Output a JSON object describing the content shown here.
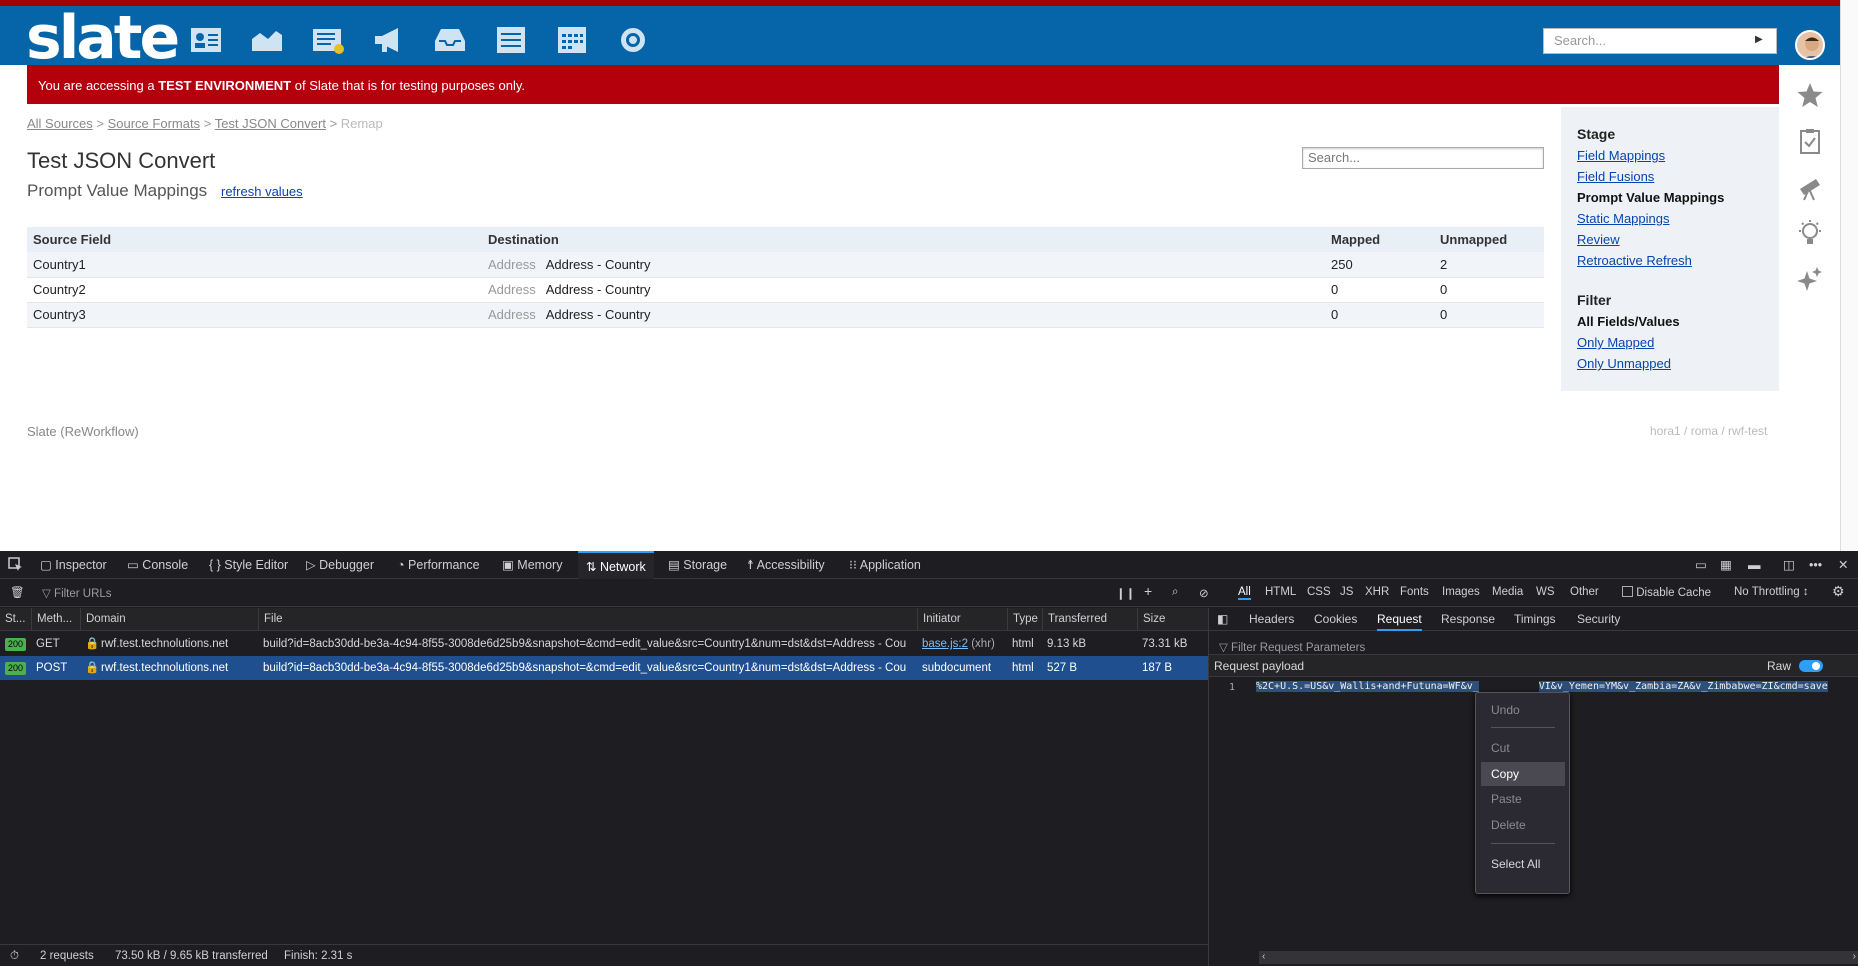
{
  "header": {
    "logo": "slate",
    "search_placeholder": "Search...",
    "nav_icons": [
      "contacts-icon",
      "chart-icon",
      "news-icon",
      "megaphone-icon",
      "inbox-icon",
      "list-icon",
      "calendar-icon",
      "settings-icon"
    ]
  },
  "banner": {
    "prefix": "You are accessing a ",
    "strong": "TEST ENVIRONMENT",
    "suffix": " of Slate that is for testing purposes only."
  },
  "breadcrumb": {
    "items": [
      "All Sources",
      "Source Formats",
      "Test JSON Convert"
    ],
    "current": "Remap",
    "sep": ">"
  },
  "page": {
    "title": "Test JSON Convert",
    "subtitle": "Prompt Value Mappings",
    "refresh": "refresh values",
    "search_placeholder": "Search..."
  },
  "table": {
    "headers": [
      "Source Field",
      "Destination",
      "Mapped",
      "Unmapped"
    ],
    "rows": [
      {
        "source": "Country1",
        "dest_prefix": "Address",
        "dest": "Address - Country",
        "mapped": "250",
        "unmapped": "2"
      },
      {
        "source": "Country2",
        "dest_prefix": "Address",
        "dest": "Address - Country",
        "mapped": "0",
        "unmapped": "0"
      },
      {
        "source": "Country3",
        "dest_prefix": "Address",
        "dest": "Address - Country",
        "mapped": "0",
        "unmapped": "0"
      }
    ]
  },
  "sidebar": {
    "stage_title": "Stage",
    "stage": [
      "Field Mappings",
      "Field Fusions",
      "Prompt Value Mappings",
      "Static Mappings",
      "Review",
      "Retroactive Refresh"
    ],
    "filter_title": "Filter",
    "filter": [
      "All Fields/Values",
      "Only Mapped",
      "Only Unmapped"
    ]
  },
  "footer": {
    "left": "Slate (ReWorkflow)",
    "right": "hora1 / roma / rwf-test"
  },
  "devtools": {
    "tabs": [
      "Inspector",
      "Console",
      "Style Editor",
      "Debugger",
      "Performance",
      "Memory",
      "Network",
      "Storage",
      "Accessibility",
      "Application"
    ],
    "filter_placeholder": "Filter URLs",
    "filters": [
      "All",
      "HTML",
      "CSS",
      "JS",
      "XHR",
      "Fonts",
      "Images",
      "Media",
      "WS",
      "Other"
    ],
    "disable_cache": "Disable Cache",
    "throttling": "No Throttling ↕",
    "columns": [
      "St...",
      "Meth...",
      "Domain",
      "File",
      "Initiator",
      "Type",
      "Transferred",
      "Size"
    ],
    "requests": [
      {
        "status": "200",
        "method": "GET",
        "domain": "rwf.test.technolutions.net",
        "file": "build?id=8acb30dd-be3a-4c94-8f55-3008de6d25b9&snapshot=&cmd=edit_value&src=Country1&num=dst&dst=Address - Cou",
        "initiator": "base.js:2",
        "initiator_suffix": " (xhr)",
        "type": "html",
        "transferred": "9.13 kB",
        "size": "73.31 kB"
      },
      {
        "status": "200",
        "method": "POST",
        "domain": "rwf.test.technolutions.net",
        "file": "build?id=8acb30dd-be3a-4c94-8f55-3008de6d25b9&snapshot=&cmd=edit_value&src=Country1&num=dst&dst=Address - Cou",
        "initiator": "subdocument",
        "initiator_suffix": "",
        "type": "html",
        "transferred": "527 B",
        "size": "187 B"
      }
    ],
    "detail_tabs": [
      "Headers",
      "Cookies",
      "Request",
      "Response",
      "Timings",
      "Security"
    ],
    "filter_params": "Filter Request Parameters",
    "payload_label": "Request payload",
    "raw_label": "Raw",
    "payload_line_no": "1",
    "payload_start": "%2C+U.S.=US&v_Wallis+and+Futuna=WF&v_",
    "payload_end": "VI&v_Yemen=YM&v_Zambia=ZA&v_Zimbabwe=ZI&cmd=save",
    "context_menu": [
      "Undo",
      "Cut",
      "Copy",
      "Paste",
      "Delete",
      "Select All"
    ],
    "status": {
      "requests": "2 requests",
      "transferred": "73.50 kB / 9.65 kB transferred",
      "finish": "Finish: 2.31 s"
    }
  }
}
